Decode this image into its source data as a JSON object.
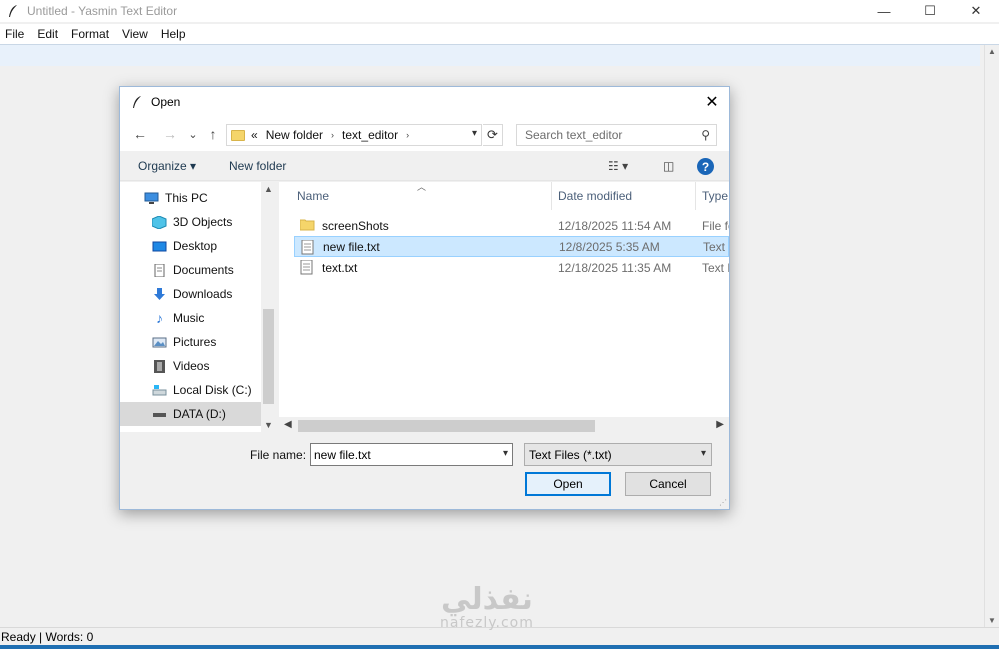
{
  "window": {
    "title": "Untitled - Yasmin Text Editor",
    "controls": {
      "minimize": "—",
      "maximize": "☐",
      "close": "✕"
    }
  },
  "menubar": {
    "items": [
      "File",
      "Edit",
      "Format",
      "View",
      "Help"
    ]
  },
  "status": {
    "text": "Ready | Words: 0"
  },
  "watermark": {
    "arabic": "نفذلي",
    "latin": "nafezly.com"
  },
  "dialog": {
    "title": "Open",
    "close": "✕",
    "nav": {
      "back": "←",
      "forward": "→",
      "recent": "⌄",
      "up": "↑"
    },
    "address": {
      "prefix": "«",
      "crumbs": [
        "New folder",
        "text_editor"
      ],
      "separator": "›"
    },
    "search": {
      "placeholder": "Search text_editor"
    },
    "commands": {
      "organize": "Organize ▾",
      "new_folder": "New folder"
    },
    "tree": [
      {
        "label": "This PC",
        "icon": "computer-icon"
      },
      {
        "label": "3D Objects",
        "icon": "cube-icon"
      },
      {
        "label": "Desktop",
        "icon": "desktop-icon"
      },
      {
        "label": "Documents",
        "icon": "document-icon"
      },
      {
        "label": "Downloads",
        "icon": "download-icon"
      },
      {
        "label": "Music",
        "icon": "music-icon"
      },
      {
        "label": "Pictures",
        "icon": "picture-icon"
      },
      {
        "label": "Videos",
        "icon": "video-icon"
      },
      {
        "label": "Local Disk (C:)",
        "icon": "disk-icon"
      },
      {
        "label": "DATA (D:)",
        "icon": "drive-icon"
      }
    ],
    "columns": {
      "name": "Name",
      "date": "Date modified",
      "type": "Type"
    },
    "files": [
      {
        "name": "screenShots",
        "date": "12/18/2025 11:54 AM",
        "type": "File fo",
        "kind": "folder"
      },
      {
        "name": "new file.txt",
        "date": "12/8/2025 5:35 AM",
        "type": "Text D",
        "kind": "text",
        "selected": true
      },
      {
        "name": "text.txt",
        "date": "12/18/2025 11:35 AM",
        "type": "Text D",
        "kind": "text"
      }
    ],
    "filename": {
      "label": "File name:",
      "value": "new file.txt"
    },
    "filter": {
      "value": "Text Files (*.txt)"
    },
    "buttons": {
      "open": "Open",
      "cancel": "Cancel"
    }
  }
}
